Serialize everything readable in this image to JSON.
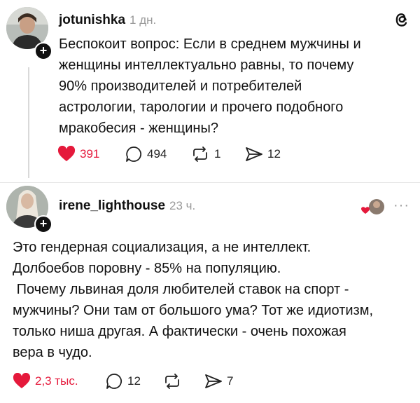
{
  "app": {
    "logo_icon": "threads-logo-icon"
  },
  "posts": [
    {
      "username": "jotunishka",
      "time": "1 дн.",
      "text": "Беспокоит вопрос: Если в среднем мужчины и\nженщины интеллектуально равны, то почему\n90% производителей и потребителей\nастрологии, тарологии и прочего подобного\nмракобесия - женщины?",
      "likes": "391",
      "liked": true,
      "comments": "494",
      "reposts": "1",
      "shares": "12"
    },
    {
      "username": "irene_lighthouse",
      "time": "23 ч.",
      "text": "Это гендерная социализация, а не интеллект.\nДолбоебов поровну - 85% на популяцию.\n Почему львиная доля любителей ставок на спорт -\nмужчины? Они там от большого ума? Тот же идиотизм,\nтолько ниша другая. А фактически - очень похожая\nвера в чудо.",
      "likes": "2,3 тыс.",
      "liked": true,
      "comments": "12",
      "reposts": "",
      "shares": "7",
      "more_icon": "ellipsis-icon"
    }
  ],
  "colors": {
    "like": "#e5193b",
    "text": "#111111",
    "muted": "#999999"
  }
}
